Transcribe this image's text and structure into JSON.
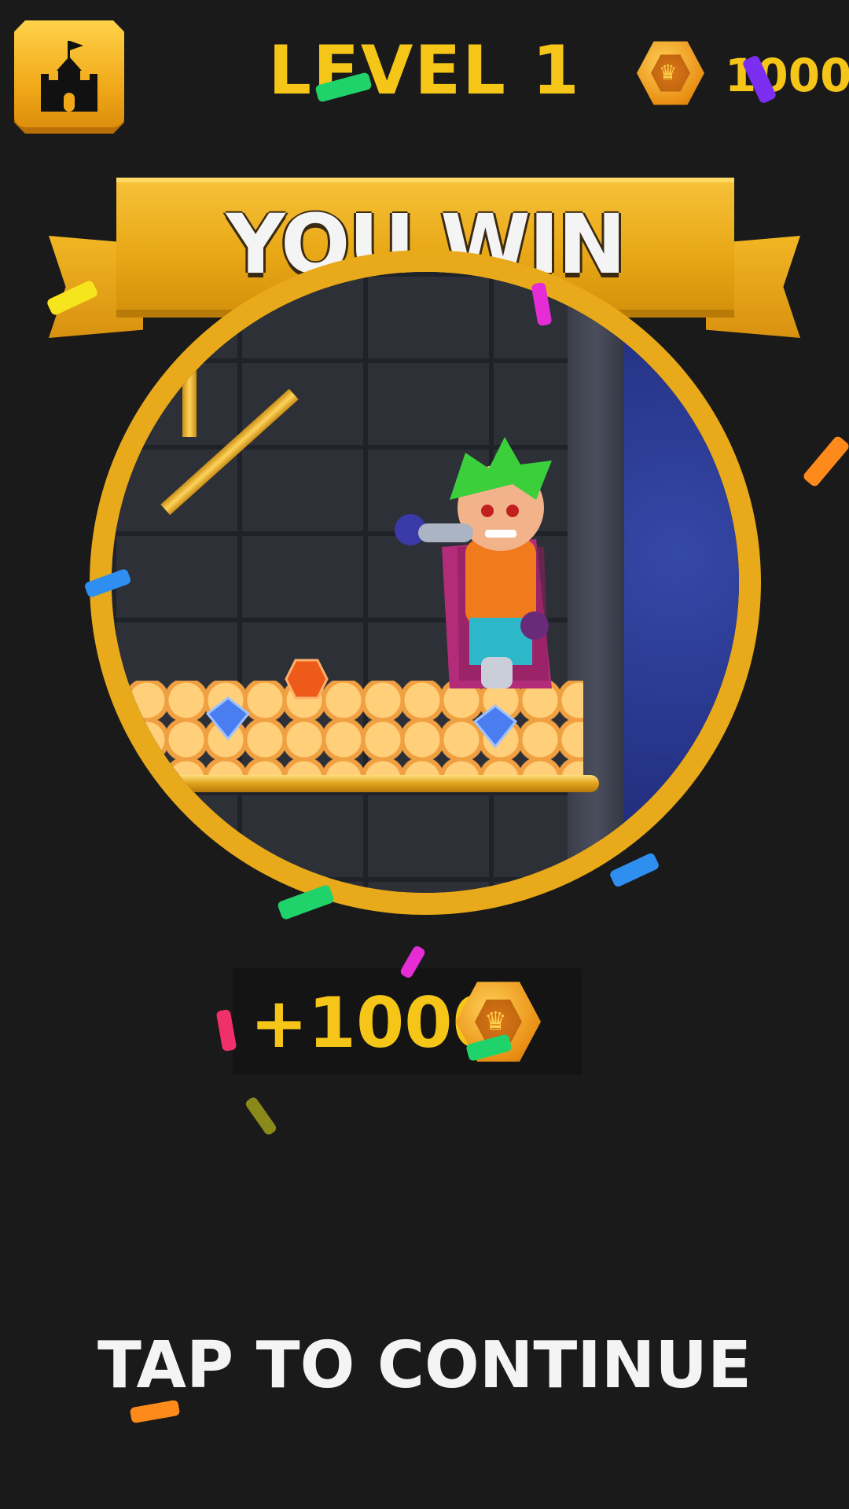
{
  "header": {
    "level_title": "LEVEL 1",
    "coin_balance": "1000"
  },
  "banner": {
    "text": "YOU WIN"
  },
  "reward": {
    "text": "+1000"
  },
  "footer": {
    "continue_label": "TAP TO CONTINUE"
  },
  "colors": {
    "gold": "#f5c518",
    "background": "#1a1a1a",
    "banner": "#e8a816",
    "white_text": "#f4f4f4"
  },
  "icons": {
    "home": "castle-icon",
    "coin": "crown-coin-icon"
  }
}
